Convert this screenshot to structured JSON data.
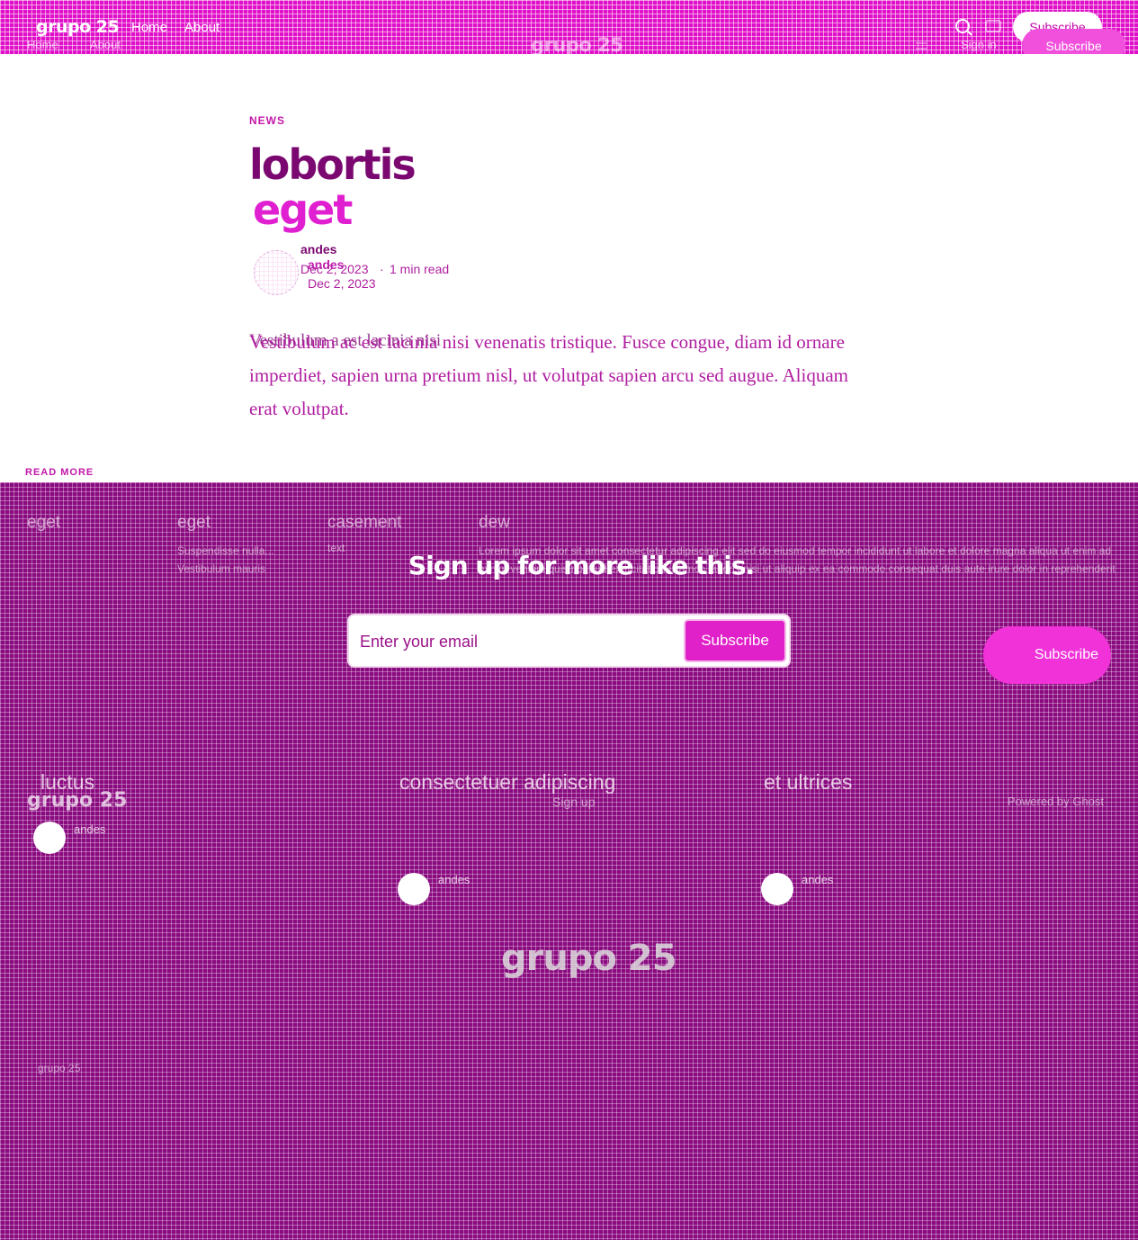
{
  "header": {
    "logo": "grupo 25",
    "logo_center": "grupo 25",
    "nav": [
      "Home",
      "About"
    ],
    "nav_ghost": [
      "Home",
      "About"
    ],
    "signin": "Sign in",
    "subscribe": "Subscribe",
    "subscribe_ghost": "Subscribe"
  },
  "article": {
    "tag": "NEWS",
    "title_line1": "lobortis",
    "title_line2": "eget",
    "author": "andes",
    "author_ghost": "andes",
    "date": "Dec 2, 2023",
    "date_ghost": "Dec 2, 2023",
    "read_time": "1 min read",
    "excerpt_ghost": "Vestibulum a est lacinia nisi",
    "body": "Vestibulum ac est lacinia nisi venenatis tristique. Fusce congue, diam id ornare imperdiet, sapien urna pretium nisl, ut volutpat sapien arcu sed augue. Aliquam erat volutpat.",
    "read_more": "READ MORE"
  },
  "related": [
    {
      "title": "eget",
      "text": ""
    },
    {
      "title": "eget",
      "text": "Suspendisse nulla... Vestibulum mauris"
    },
    {
      "title": "casement",
      "text": "text"
    },
    {
      "title": "dew",
      "text": "Lorem ipsum dolor sit amet consectetur adipiscing elit sed do eiusmod tempor incididunt ut labore et dolore magna aliqua ut enim ad minim veniam quis nostrud exercitation ullamco laboris nisi ut aliquip ex ea commodo consequat duis aute irure dolor in reprehenderit"
    }
  ],
  "signup": {
    "heading": "Sign up for more like this.",
    "placeholder": "Enter your email",
    "button": "Subscribe",
    "big_button": "Subscribe"
  },
  "sections": [
    {
      "title": "luctus",
      "author": "andes"
    },
    {
      "title": "consectetuer adipiscing",
      "author": "andes"
    },
    {
      "title": "et ultrices",
      "author": "andes"
    }
  ],
  "footer": {
    "logo": "grupo 25",
    "signup_link": "Sign up",
    "powered": "Powered by Ghost",
    "big_logo": "grupo 25",
    "copyright": "grupo 25"
  }
}
